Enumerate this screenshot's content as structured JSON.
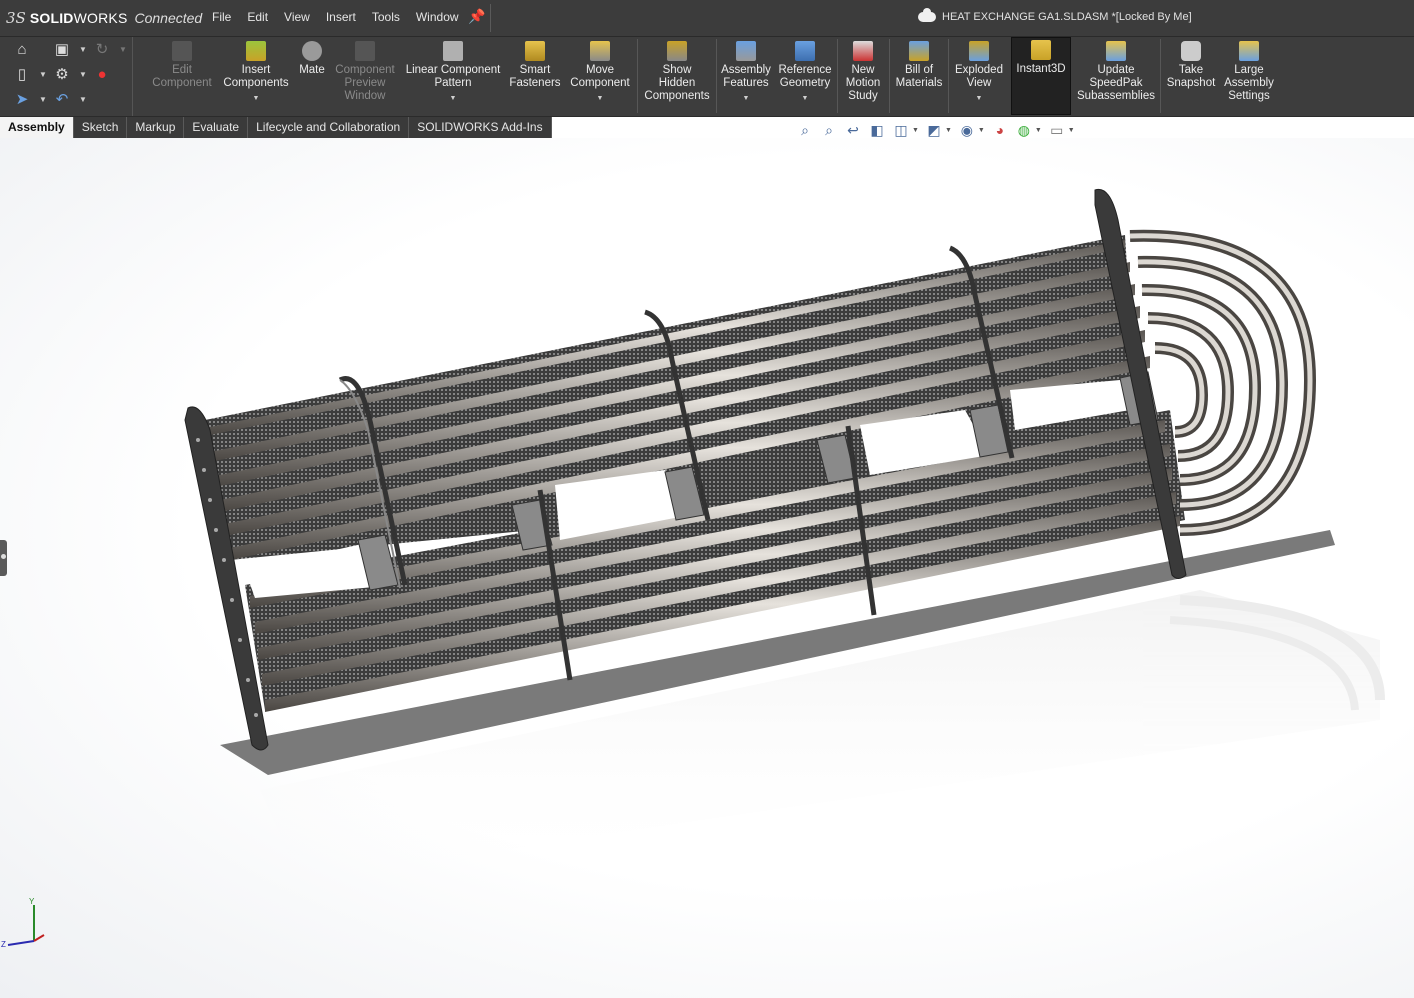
{
  "app": {
    "brand_prefix": "SOLID",
    "brand_suffix": "WORKS",
    "brand_variant": "Connected",
    "document_title": "HEAT EXCHANGE GA1.SLDASM *[Locked By Me]"
  },
  "menu": [
    "File",
    "Edit",
    "View",
    "Insert",
    "Tools",
    "Window"
  ],
  "ribbon": {
    "edit_component": [
      "Edit",
      "Component"
    ],
    "insert_components": [
      "Insert",
      "Components"
    ],
    "mate": [
      "Mate"
    ],
    "preview_window": [
      "Component",
      "Preview",
      "Window"
    ],
    "linear_pattern": [
      "Linear Component",
      "Pattern"
    ],
    "smart_fasteners": [
      "Smart",
      "Fasteners"
    ],
    "move_component": [
      "Move",
      "Component"
    ],
    "show_hidden": [
      "Show",
      "Hidden",
      "Components"
    ],
    "assembly_features": [
      "Assembly",
      "Features"
    ],
    "reference_geometry": [
      "Reference",
      "Geometry"
    ],
    "motion_study": [
      "New",
      "Motion",
      "Study"
    ],
    "bill_of_materials": [
      "Bill of",
      "Materials"
    ],
    "exploded_view": [
      "Exploded",
      "View"
    ],
    "instant3d": [
      "Instant3D"
    ],
    "speedpak": [
      "Update",
      "SpeedPak",
      "Subassemblies"
    ],
    "snapshot": [
      "Take",
      "Snapshot"
    ],
    "large_assembly": [
      "Large",
      "Assembly",
      "Settings"
    ]
  },
  "tabs": [
    "Assembly",
    "Sketch",
    "Markup",
    "Evaluate",
    "Lifecycle and Collaboration",
    "SOLIDWORKS Add-Ins"
  ],
  "triad": {
    "y": "Y",
    "z": "Z"
  },
  "colors": {
    "titlebar": "#3c3c3c",
    "ribbon": "#3d3d3d",
    "accent": "#4a6a9a",
    "metal": "#8a8580"
  }
}
